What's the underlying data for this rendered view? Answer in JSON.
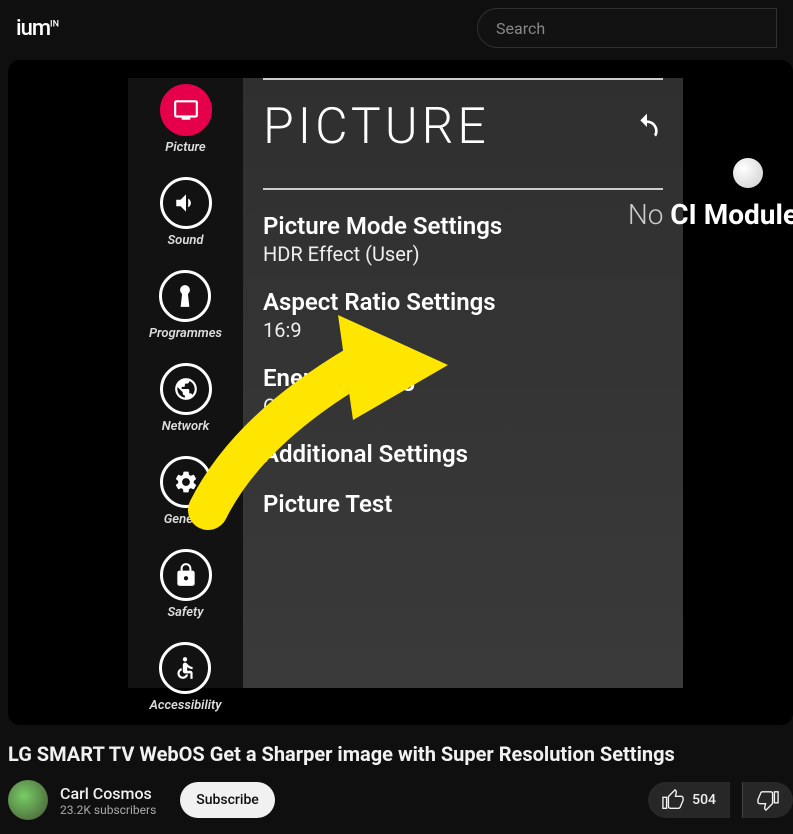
{
  "header": {
    "logo_fragment": "ium",
    "logo_sup": "IN",
    "search_placeholder": "Search"
  },
  "tv_osd": {
    "title": "PICTURE",
    "sidebar": [
      {
        "label": "Picture",
        "icon": "picture-icon",
        "active": true
      },
      {
        "label": "Sound",
        "icon": "sound-icon"
      },
      {
        "label": "Programmes",
        "icon": "programmes-icon"
      },
      {
        "label": "Network",
        "icon": "network-icon"
      },
      {
        "label": "General",
        "icon": "general-icon"
      },
      {
        "label": "Safety",
        "icon": "safety-icon"
      },
      {
        "label": "Accessibility",
        "icon": "accessibility-icon"
      }
    ],
    "settings": [
      {
        "label": "Picture Mode Settings",
        "value": "HDR Effect (User)"
      },
      {
        "label": "Aspect Ratio Settings",
        "value": "16:9"
      },
      {
        "label": "Energy Saving",
        "value": "Off"
      },
      {
        "label": "Additional Settings",
        "value": ""
      },
      {
        "label": "Picture Test",
        "value": ""
      }
    ],
    "side_text_pre": "No ",
    "side_text_bold": "CI Module"
  },
  "video": {
    "title": "LG SMART TV WebOS Get a Sharper image with Super Resolution Settings",
    "channel": "Carl Cosmos",
    "subscribers": "23.2K subscribers",
    "subscribe_label": "Subscribe",
    "likes": "504"
  }
}
